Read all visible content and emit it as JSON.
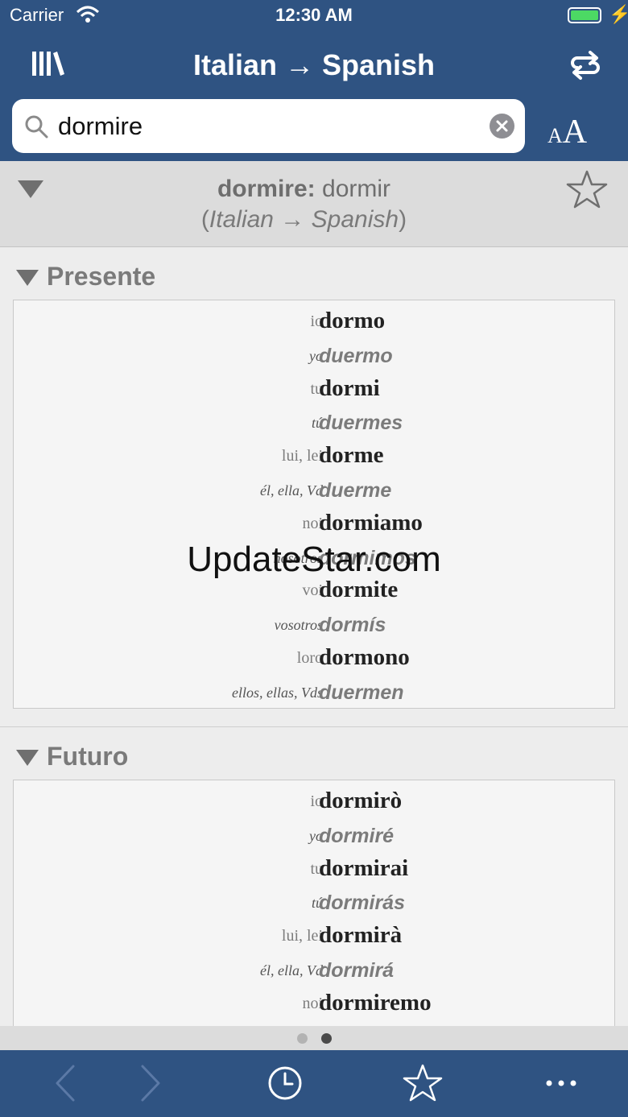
{
  "status": {
    "carrier": "Carrier",
    "time": "12:30 AM"
  },
  "nav": {
    "title": "Italian → Spanish"
  },
  "search": {
    "value": "dormire"
  },
  "entry": {
    "word": "dormire",
    "separator": ":",
    "translation": "dormir",
    "direction": "Italian → Spanish",
    "paren_open": "(",
    "paren_close": ")"
  },
  "sections": [
    {
      "label": "Presente",
      "rows": [
        {
          "pron": "io",
          "verb": "dormo",
          "lang": "it"
        },
        {
          "pron": "yo",
          "verb": "duermo",
          "lang": "es"
        },
        {
          "pron": "tu",
          "verb": "dormi",
          "lang": "it"
        },
        {
          "pron": "tú",
          "verb": "duermes",
          "lang": "es"
        },
        {
          "pron": "lui, lei",
          "verb": "dorme",
          "lang": "it"
        },
        {
          "pron": "él, ella, Vd",
          "verb": "duerme",
          "lang": "es"
        },
        {
          "pron": "noi",
          "verb": "dormiamo",
          "lang": "it"
        },
        {
          "pron": "nosotros",
          "verb": "dormimos",
          "lang": "es"
        },
        {
          "pron": "voi",
          "verb": "dormite",
          "lang": "it"
        },
        {
          "pron": "vosotros",
          "verb": "dormís",
          "lang": "es"
        },
        {
          "pron": "loro",
          "verb": "dormono",
          "lang": "it"
        },
        {
          "pron": "ellos, ellas, Vds",
          "verb": "duermen",
          "lang": "es"
        }
      ]
    },
    {
      "label": "Futuro",
      "rows": [
        {
          "pron": "io",
          "verb": "dormirò",
          "lang": "it"
        },
        {
          "pron": "yo",
          "verb": "dormiré",
          "lang": "es"
        },
        {
          "pron": "tu",
          "verb": "dormirai",
          "lang": "it"
        },
        {
          "pron": "tú",
          "verb": "dormirás",
          "lang": "es"
        },
        {
          "pron": "lui, lei",
          "verb": "dormirà",
          "lang": "it"
        },
        {
          "pron": "él, ella, Vd",
          "verb": "dormirá",
          "lang": "es"
        },
        {
          "pron": "noi",
          "verb": "dormiremo",
          "lang": "it"
        }
      ]
    }
  ],
  "watermark": "UpdateStar.com",
  "pager": {
    "pages": 2,
    "current": 2
  },
  "colors": {
    "bar": "#2f5382",
    "battery": "#4cd964"
  },
  "icons": [
    "library-icon",
    "swap-direction-icon",
    "search-icon",
    "clear-icon",
    "font-size-icon",
    "star-icon",
    "back-arrow-icon",
    "forward-arrow-icon",
    "history-clock-icon",
    "favorites-star-icon",
    "more-icon"
  ]
}
